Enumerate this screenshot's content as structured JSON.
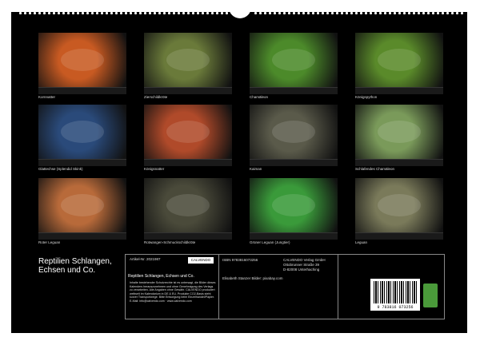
{
  "title": "Reptilien Schlangen, Echsen und Co.",
  "tiles": [
    {
      "caption": "Kornnatter",
      "color": "#c85a22"
    },
    {
      "caption": "Zierschildkröte",
      "color": "#6a7a3a"
    },
    {
      "caption": "Chamäleon",
      "color": "#4c8a2a"
    },
    {
      "caption": "Königspython",
      "color": "#5a8a2a"
    },
    {
      "caption": "Glattechse (Splendid Skink)",
      "color": "#2a4a7a"
    },
    {
      "caption": "Königsnatter",
      "color": "#b04a2a"
    },
    {
      "caption": "Kaiman",
      "color": "#5a5a4a"
    },
    {
      "caption": "Schlafendes Chamäleon",
      "color": "#7a9a5a"
    },
    {
      "caption": "Roter Leguan",
      "color": "#b86a3a"
    },
    {
      "caption": "Rotwangen-Schmuckschildkröte",
      "color": "#4a4a3a"
    },
    {
      "caption": "Grüner Leguan (Jungtier)",
      "color": "#3a9a3a"
    },
    {
      "caption": "Leguan",
      "color": "#7a7a5a"
    }
  ],
  "info": {
    "article": "Artikel-Nr. 2021987",
    "publisher_logo": "CALVENDO",
    "title_repeat": "Reptilien Schlangen, Echsen und Co.",
    "legal": "Inhalte bestehender Schutzrechte ist es untersagt, die Bilder dieses Kalenders herauszunehmen und ohne Genehmigung des Verlags zu verarbeiten. Alle Angaben ohne Gewähr. CALVENDO produziert weltweit im Kalendarium in DE & EU. Produkte CO2-Basis steht kurzer Transportwege. Bitte Entsorgung beim Einzelhandel/Papier. E-Mail: info@calvendo.com · www.calvendo.com",
    "isbn": "ISBN 9783816073256",
    "image_credit": "Elisabeth Stanzer Bilder: pixabay.com",
    "company": "CALVENDO Verlag GmbH",
    "street": "Ottobrunner Straße 39",
    "city": "D-82008 Unterhaching",
    "barcode_number": "9 783816 073256"
  }
}
